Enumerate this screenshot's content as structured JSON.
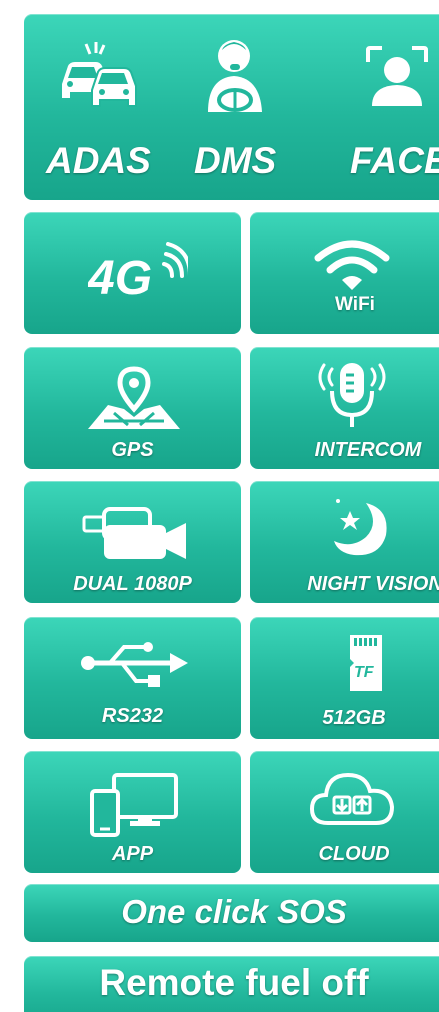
{
  "top_banner": {
    "items": [
      {
        "label": "ADAS",
        "icon": "car-collision-icon"
      },
      {
        "label": "DMS",
        "icon": "driver-monitor-icon"
      },
      {
        "label": "FACE",
        "icon": "face-recognition-icon"
      }
    ]
  },
  "features": [
    {
      "label": "",
      "icon": "4g-signal-icon",
      "icon_text": "4G"
    },
    {
      "label": "WiFi",
      "icon": "wifi-icon"
    },
    {
      "label": "GPS",
      "icon": "gps-map-pin-icon"
    },
    {
      "label": "INTERCOM",
      "icon": "microphone-icon"
    },
    {
      "label": "DUAL 1080P",
      "icon": "video-camera-icon"
    },
    {
      "label": "NIGHT VISION",
      "icon": "moon-star-icon"
    },
    {
      "label": "RS232",
      "icon": "usb-icon"
    },
    {
      "label": "512GB",
      "icon": "tf-card-icon",
      "icon_text": "TF"
    },
    {
      "label": "APP",
      "icon": "devices-icon"
    },
    {
      "label": "CLOUD",
      "icon": "cloud-transfer-icon"
    }
  ],
  "bars": {
    "sos": "One click SOS",
    "fuel": "Remote fuel off"
  },
  "colors": {
    "tile_top": "#3cd6b9",
    "tile_bottom": "#17a58b",
    "text": "#ffffff"
  }
}
